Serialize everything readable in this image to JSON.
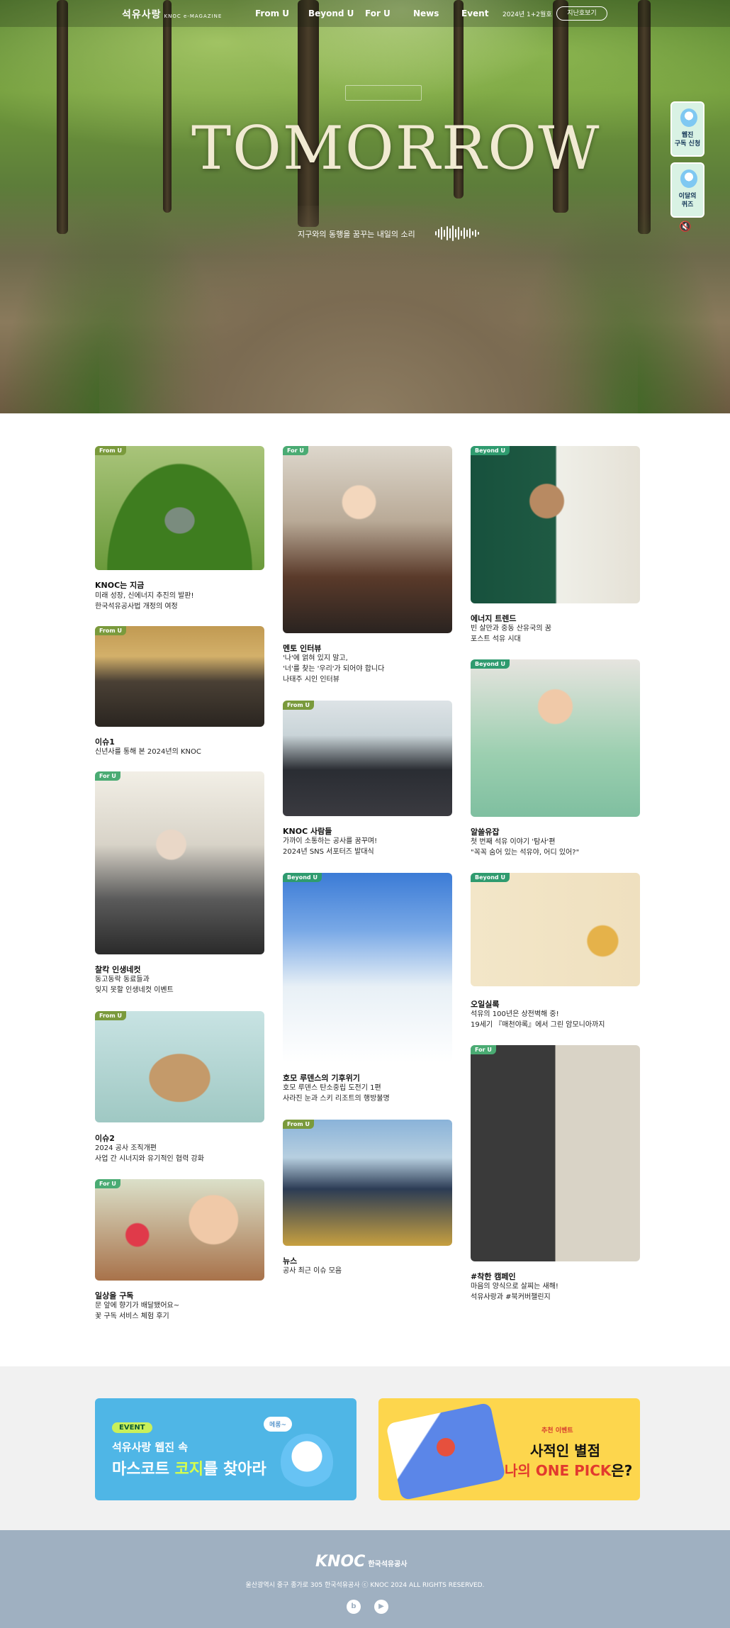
{
  "nav": {
    "logo": "석유사랑",
    "logo_sub": "KNOC e-MAGAZINE",
    "items": [
      "From U",
      "Beyond U",
      "For U",
      "News",
      "Event"
    ],
    "issue": "2024년 1+2월호",
    "prev_issue": "지난호보기"
  },
  "hero": {
    "title": "TOMORROW",
    "subtitle": "지구와의 동행을 꿈꾸는 내일의 소리",
    "season_badge": ""
  },
  "side": {
    "subscribe": [
      "웹진",
      "구독 신청"
    ],
    "quiz": [
      "이달의",
      "퀴즈"
    ]
  },
  "cards": [
    {
      "tag": "From U",
      "title": "KNOC는 지금",
      "desc": [
        "미래 성장, 신에너지 추진의 발판!",
        "한국석유공사법 개정의 여정"
      ]
    },
    {
      "tag": "From U",
      "title": "이슈1",
      "desc": [
        "신년사를 통해 본 2024년의 KNOC"
      ]
    },
    {
      "tag": "For U",
      "title": "찰칵 인생네컷",
      "desc": [
        "동고동락 동료들과",
        "잊지 못할 인생네컷 이벤트"
      ]
    },
    {
      "tag": "From U",
      "title": "이슈2",
      "desc": [
        "2024 공사 조직개편",
        "사업 간 시너지와 유기적인 협력 강화"
      ]
    },
    {
      "tag": "For U",
      "title": "일상을 구독",
      "desc": [
        "문 앞에 향기가 배달됐어요~",
        "꽃 구독 서비스 체험 후기"
      ]
    },
    {
      "tag": "For U",
      "title": "멘토 인터뷰",
      "desc": [
        "'나'에 얽혀 있지 말고,",
        "'너'를 찾는 '우리'가 되어야 합니다",
        "나태주 시인 인터뷰"
      ]
    },
    {
      "tag": "From U",
      "title": "KNOC 사람들",
      "desc": [
        "가까이 소통하는 공사를 꿈꾸며!",
        "2024년 SNS 서포터즈 발대식"
      ]
    },
    {
      "tag": "Beyond U",
      "title": "호모 루덴스의 기후위기",
      "desc": [
        "호모 루덴스 탄소중립 도전기 1편",
        "사라진 눈과 스키 리조트의 행방불명"
      ]
    },
    {
      "tag": "From U",
      "title": "뉴스",
      "desc": [
        "공사 최근 이슈 모음"
      ]
    },
    {
      "tag": "Beyond U",
      "title": "에너지 트렌드",
      "desc": [
        "빈 살만과 중동 산유국의 꿈",
        "포스트 석유 시대"
      ]
    },
    {
      "tag": "Beyond U",
      "title": "알쓸유잡",
      "desc": [
        "첫 번째 석유 이야기 '탐사'편",
        "\"꼭꼭 숨어 있는 석유야, 어디 있어?\""
      ]
    },
    {
      "tag": "Beyond U",
      "title": "오일실록",
      "desc": [
        "석유의 100년은 상전벽해 중!",
        "19세기 『매천야록』에서 그린 암모니아까지"
      ]
    },
    {
      "tag": "For U",
      "title": "#착한 캠페인",
      "desc": [
        "마음의 양식으로 살찌는 새해!",
        "석유사랑과 #북커버챌린지"
      ]
    }
  ],
  "banner1": {
    "pill": "EVENT",
    "line1": "석유사랑 웹진 속",
    "line2_a": "마스코트",
    "line2_b": "코지",
    "line2_c": "를 찾아라",
    "bubble": "메롱~"
  },
  "banner2": {
    "event": "추천 이벤트",
    "line1": "사적인 별점",
    "line2_a": "나의 ONE PICK",
    "line2_b": "은?"
  },
  "footer": {
    "logo": "KNOC",
    "logo_sub": "한국석유공사",
    "address": "울산광역시 중구 종가로 305 한국석유공사 ⓒ KNOC 2024 ALL RIGHTS RESERVED.",
    "sns": [
      "blog",
      "youtube"
    ]
  },
  "colors": {
    "accent": "#4aab73",
    "footer_bg": "#9fb0c1",
    "banner_blue": "#4fb6e6",
    "banner_yellow": "#fdd64d"
  }
}
